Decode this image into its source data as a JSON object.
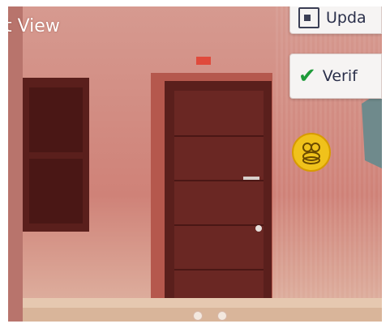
{
  "header": {
    "title": "t View"
  },
  "actions": {
    "upload_label": "Upda",
    "verify_label": "Verif"
  },
  "icons": {
    "upload": "upload-icon",
    "verify": "checkmark-icon",
    "coin": "coin-icon"
  },
  "colors": {
    "wall": "#c9857c",
    "door": "#5a1f1c",
    "check": "#1f9b3a",
    "coin": "#f0c21b"
  },
  "carousel": {
    "pages": 2,
    "current": 1
  }
}
